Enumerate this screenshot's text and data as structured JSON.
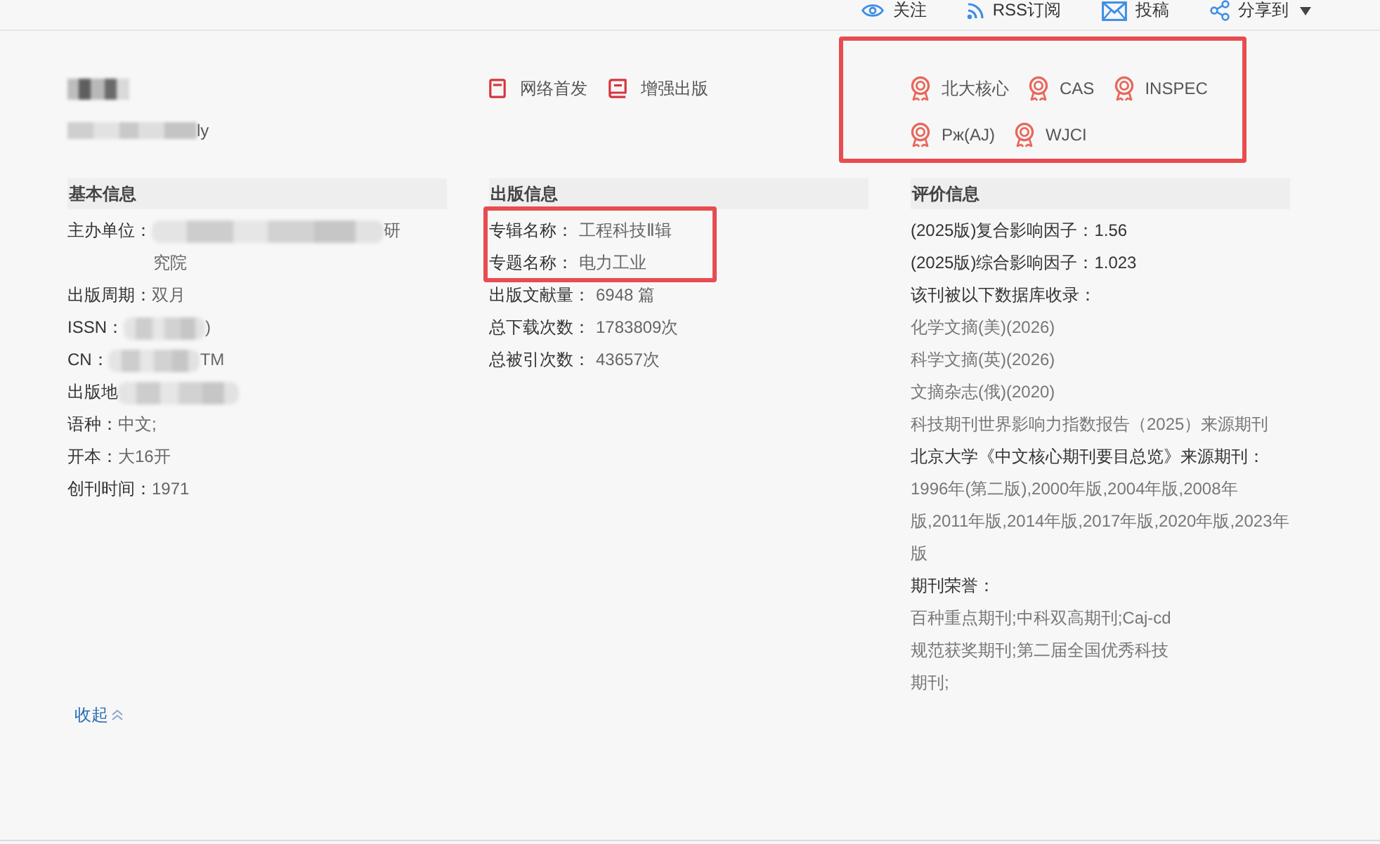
{
  "top_nav": [
    {
      "label": "关注",
      "dropdown": false
    },
    {
      "label": "RSS订阅",
      "dropdown": false
    },
    {
      "label": "投稿",
      "dropdown": false
    },
    {
      "label": "分享到",
      "dropdown": true
    }
  ],
  "journal": {
    "subtitle_end": "ly"
  },
  "publish_links": [
    {
      "label": "网络首发"
    },
    {
      "label": "增强出版"
    }
  ],
  "badges": {
    "highlighted": true,
    "items": [
      {
        "label": "北大核心"
      },
      {
        "label": "CAS"
      },
      {
        "label": "INSPEC"
      },
      {
        "label": "Рж(AJ)"
      },
      {
        "label": "WJCI"
      }
    ]
  },
  "basic_info": {
    "title": "基本信息",
    "rows": [
      {
        "kind": "redacted",
        "label": "主办单位：",
        "tail": "研",
        "continuation": "究院"
      },
      {
        "kind": "text",
        "label": "出版周期：",
        "value": "双月"
      },
      {
        "kind": "redacted",
        "label": "ISSN：",
        "tail": ")"
      },
      {
        "kind": "redacted",
        "label": "CN：",
        "tail": "TM"
      },
      {
        "kind": "redacted",
        "label": "出版地"
      },
      {
        "kind": "text",
        "label": "语种：",
        "value": "中文;"
      },
      {
        "kind": "text",
        "label": "开本：",
        "value": "大16开"
      },
      {
        "kind": "text",
        "label": "创刊时间：",
        "value": "1971"
      }
    ]
  },
  "publication_info": {
    "title": "出版信息",
    "row_groups": [
      {
        "highlighted": true,
        "rows": [
          {
            "label": "专辑名称：",
            "value": "工程科技Ⅱ辑"
          },
          {
            "label": "专题名称：",
            "value": "电力工业"
          }
        ]
      },
      {
        "highlighted": false,
        "rows": [
          {
            "label": "出版文献量：",
            "value": "6948 篇"
          },
          {
            "label": "总下载次数：",
            "value": "1783809次"
          },
          {
            "label": "总被引次数：",
            "value": "43657次"
          }
        ]
      }
    ]
  },
  "evaluation_info": {
    "title": "评价信息",
    "lines": [
      {
        "kind": "label",
        "text": "(2025版)复合影响因子：1.56"
      },
      {
        "kind": "label",
        "text": "(2025版)综合影响因子：1.023"
      },
      {
        "kind": "label",
        "text": "该刊被以下数据库收录："
      },
      {
        "kind": "value",
        "text": "化学文摘(美)(2026)"
      },
      {
        "kind": "value",
        "text": "科学文摘(英)(2026)"
      },
      {
        "kind": "value",
        "text": "文摘杂志(俄)(2020)"
      },
      {
        "kind": "value",
        "text": "科技期刊世界影响力指数报告（2025）来源期刊"
      },
      {
        "kind": "label",
        "text": "北京大学《中文核心期刊要目总览》来源期刊："
      },
      {
        "kind": "value",
        "text": "1996年(第二版),2000年版,2004年版,2008年"
      },
      {
        "kind": "value",
        "text": "版,2011年版,2014年版,2017年版,2020年版,2023年"
      },
      {
        "kind": "value",
        "text": "版"
      },
      {
        "kind": "label",
        "text": "期刊荣誉："
      },
      {
        "kind": "value",
        "text": "百种重点期刊;中科双高期刊;Caj-cd"
      },
      {
        "kind": "value",
        "text": "规范获奖期刊;第二届全国优秀科技"
      },
      {
        "kind": "value",
        "text": "期刊;"
      }
    ]
  },
  "collapse_link": {
    "label": "收起"
  }
}
